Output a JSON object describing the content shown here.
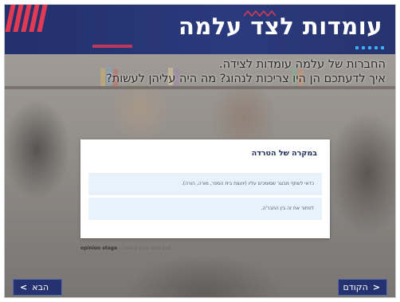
{
  "header": {
    "title": "עומדות לצד עלמה"
  },
  "intro": {
    "line1": "החברות של עלמה עומדות לצידה.",
    "line2": "איך לדעתכם הן היו צריכות לנהוג? מה היה עליהן לעשות?"
  },
  "poll": {
    "question": "במקרה של הטרדה",
    "options": [
      {
        "label": "כדאי לשתף מבוגר שסומכים עליו (יועצת בית הספר, מורה, הורה)."
      },
      {
        "label": "לפתור את זה בין החבר'ה."
      }
    ]
  },
  "credit": {
    "brand": "opinion stage",
    "link": " - create your own poll"
  },
  "nav": {
    "next_label": "הבא",
    "prev_label": "הקודם"
  },
  "colors": {
    "header_bg": "#2b3a7c",
    "accent": "#e23a52",
    "dots": "#3fb0ff",
    "option_bg": "#e7f2fb",
    "nav_bg": "#243270"
  }
}
